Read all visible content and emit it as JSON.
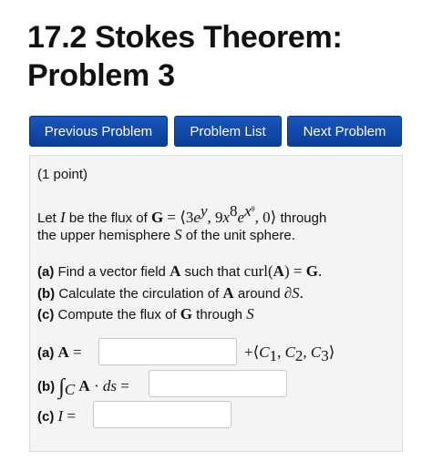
{
  "title": {
    "line1": "17.2 Stokes Theorem:",
    "line2": "Problem 3"
  },
  "nav": {
    "previous_label": "Previous Problem",
    "list_label": "Problem List",
    "next_label": "Next Problem"
  },
  "problem": {
    "points": "(1 point)",
    "intro": {
      "let": "Let ",
      "I": "I",
      "be_flux_of": " be the flux of ",
      "G": "G",
      "eq_open": " = ⟨3",
      "e": "e",
      "y_exp": "y",
      "comma1": ", 9",
      "x": "x",
      "eight": "8",
      "e2": "e",
      "x_exp": "x",
      "nine_exp": "9",
      "close": ", 0⟩",
      "through": " through",
      "line2_a": "the upper hemisphere ",
      "S": "S",
      "line2_b": " of the unit sphere."
    },
    "parts": {
      "a_label": "(a)",
      "a_text1": " Find a vector field ",
      "a_A": "A",
      "a_text2": " such that ",
      "a_curl": "curl(",
      "a_A2": "A",
      "a_eq": ") = ",
      "a_G": "G",
      "a_dot": ".",
      "b_label": "(b)",
      "b_text1": " Calculate the circulation of ",
      "b_A": "A",
      "b_text2": " around ",
      "b_dS": "∂S",
      "b_dot": ".",
      "c_label": "(c)",
      "c_text1": " Compute the flux of ",
      "c_G": "G",
      "c_text2": " through ",
      "c_S": "S"
    },
    "answers": {
      "a_label": "(a)",
      "a_A": "A",
      "a_eq": " =",
      "a_plus": "+⟨",
      "C1": "C",
      "s1": "1",
      "C2": "C",
      "s2": "2",
      "C3": "C",
      "s3": "3",
      "comma": ", ",
      "a_close": "⟩",
      "b_label": "(b)",
      "b_int": "∫",
      "b_C": "C",
      "b_A": "A",
      "b_rest": " · ",
      "b_ds": "ds",
      "b_eq": " =",
      "c_label": "(c)",
      "c_I": "I",
      "c_eq": " ="
    },
    "inputs": {
      "a_value": "",
      "b_value": "",
      "c_value": ""
    }
  }
}
